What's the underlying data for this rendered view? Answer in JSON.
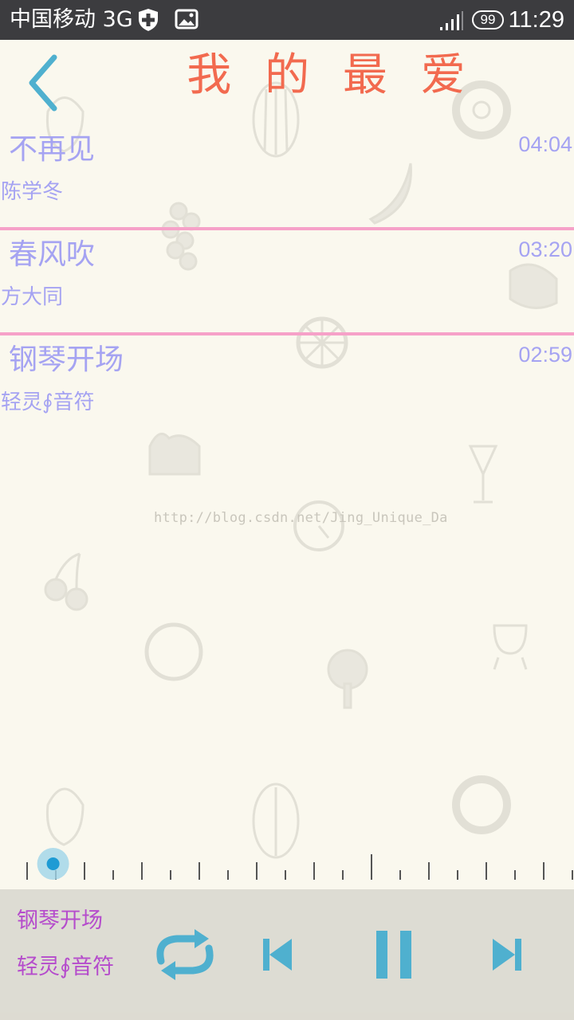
{
  "status_bar": {
    "carrier": "中国移动 3G",
    "battery": "99",
    "time": "11:29"
  },
  "header": {
    "title": "我 的 最 爱"
  },
  "songs": [
    {
      "title": "不再见",
      "artist": "陈学冬",
      "duration": "04:04"
    },
    {
      "title": "春风吹",
      "artist": "方大同",
      "duration": "03:20"
    },
    {
      "title": "钢琴开场",
      "artist": "轻灵∮音符",
      "duration": "02:59"
    }
  ],
  "watermark": "http://blog.csdn.net/Jing_Unique_Da",
  "seek": {
    "progress": 0.05
  },
  "player": {
    "now_title": "钢琴开场",
    "now_artist": "轻灵∮音符",
    "controls": [
      "repeat-icon",
      "previous-icon",
      "pause-icon",
      "next-icon"
    ]
  },
  "colors": {
    "title": "#f26a4f",
    "list_text": "#a5a3f2",
    "divider": "#f6a1c8",
    "accent": "#4fb0cf",
    "now_playing_text": "#b54ccc",
    "background": "#faf8ee"
  }
}
